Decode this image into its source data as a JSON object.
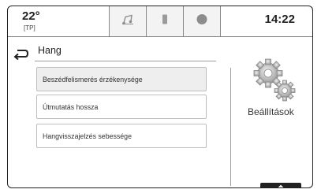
{
  "status": {
    "temperature": "22°",
    "temperature_sub": "[TP]",
    "time": "14:22"
  },
  "tabs": [
    {
      "icon": "music-note-icon"
    },
    {
      "icon": "phone-icon"
    },
    {
      "icon": "nav-dot-icon"
    }
  ],
  "header": {
    "back_icon": "back-arrow-icon",
    "title": "Hang"
  },
  "menu": {
    "items": [
      {
        "label": "Beszédfelismerés érzékenysége",
        "selected": true
      },
      {
        "label": "Útmutatás hossza",
        "selected": false
      },
      {
        "label": "Hangvisszajelzés sebessége",
        "selected": false
      }
    ]
  },
  "side": {
    "icon": "gears-icon",
    "label": "Beállítások"
  },
  "footer": {
    "scroll_icon": "chevron-up-icon"
  }
}
